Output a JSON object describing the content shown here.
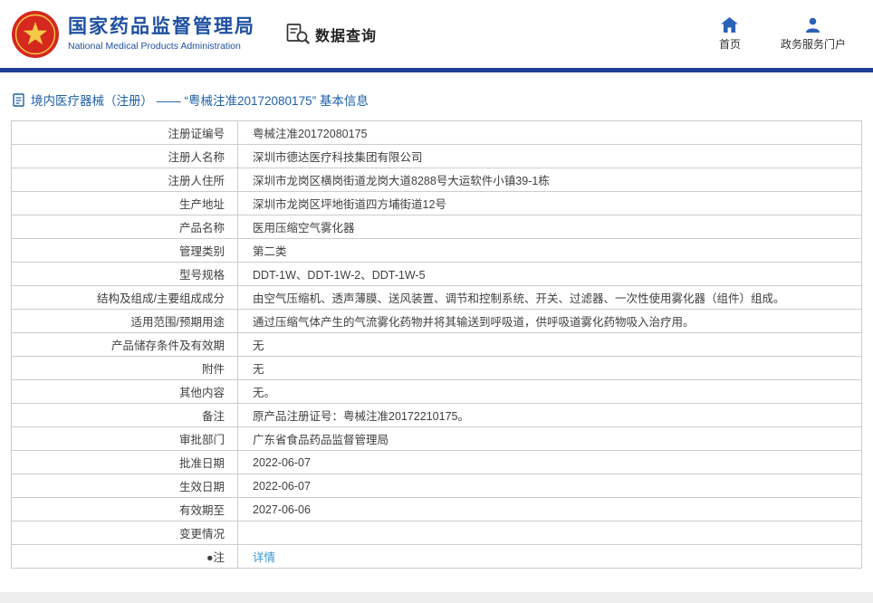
{
  "header": {
    "org_name_cn": "国家药品监督管理局",
    "org_name_en": "National Medical Products Administration",
    "query_label": "数据查询",
    "nav": [
      {
        "label": "首页",
        "icon": "home-icon"
      },
      {
        "label": "政务服务门户",
        "icon": "user-icon"
      }
    ]
  },
  "colors": {
    "brand_blue": "#1e50a2",
    "bar_blue": "#1c3f94",
    "title_blue": "#1d5fa9",
    "link_blue": "#3b96d2",
    "emblem_red": "#d5281e",
    "emblem_gold": "#f7c948"
  },
  "breadcrumb": {
    "text": "境内医疗器械（注册） ——  “粤械注准20172080175” 基本信息"
  },
  "table": {
    "rows": [
      {
        "label": "注册证编号",
        "value": "粤械注准20172080175"
      },
      {
        "label": "注册人名称",
        "value": "深圳市德达医疗科技集团有限公司"
      },
      {
        "label": "注册人住所",
        "value": "深圳市龙岗区横岗街道龙岗大道8288号大运软件小镇39-1栋"
      },
      {
        "label": "生产地址",
        "value": "深圳市龙岗区坪地街道四方埔街道12号"
      },
      {
        "label": "产品名称",
        "value": "医用压缩空气雾化器"
      },
      {
        "label": "管理类别",
        "value": "第二类"
      },
      {
        "label": "型号规格",
        "value": "DDT-1W、DDT-1W-2、DDT-1W-5"
      },
      {
        "label": "结构及组成/主要组成成分",
        "value": "由空气压缩机、透声薄膜、送风装置、调节和控制系统、开关、过滤器、一次性使用雾化器（组件）组成。"
      },
      {
        "label": "适用范围/预期用途",
        "value": "通过压缩气体产生的气流雾化药物并将其输送到呼吸道，供呼吸道雾化药物吸入治疗用。"
      },
      {
        "label": "产品储存条件及有效期",
        "value": "无"
      },
      {
        "label": "附件",
        "value": "无"
      },
      {
        "label": "其他内容",
        "value": "无。"
      },
      {
        "label": "备注",
        "value": "原产品注册证号：粤械注准20172210175。"
      },
      {
        "label": "审批部门",
        "value": "广东省食品药品监督管理局"
      },
      {
        "label": "批准日期",
        "value": "2022-06-07"
      },
      {
        "label": "生效日期",
        "value": "2022-06-07"
      },
      {
        "label": "有效期至",
        "value": "2027-06-06"
      },
      {
        "label": "变更情况",
        "value": ""
      },
      {
        "label": "●注",
        "value": "详情",
        "is_link": true
      }
    ]
  }
}
